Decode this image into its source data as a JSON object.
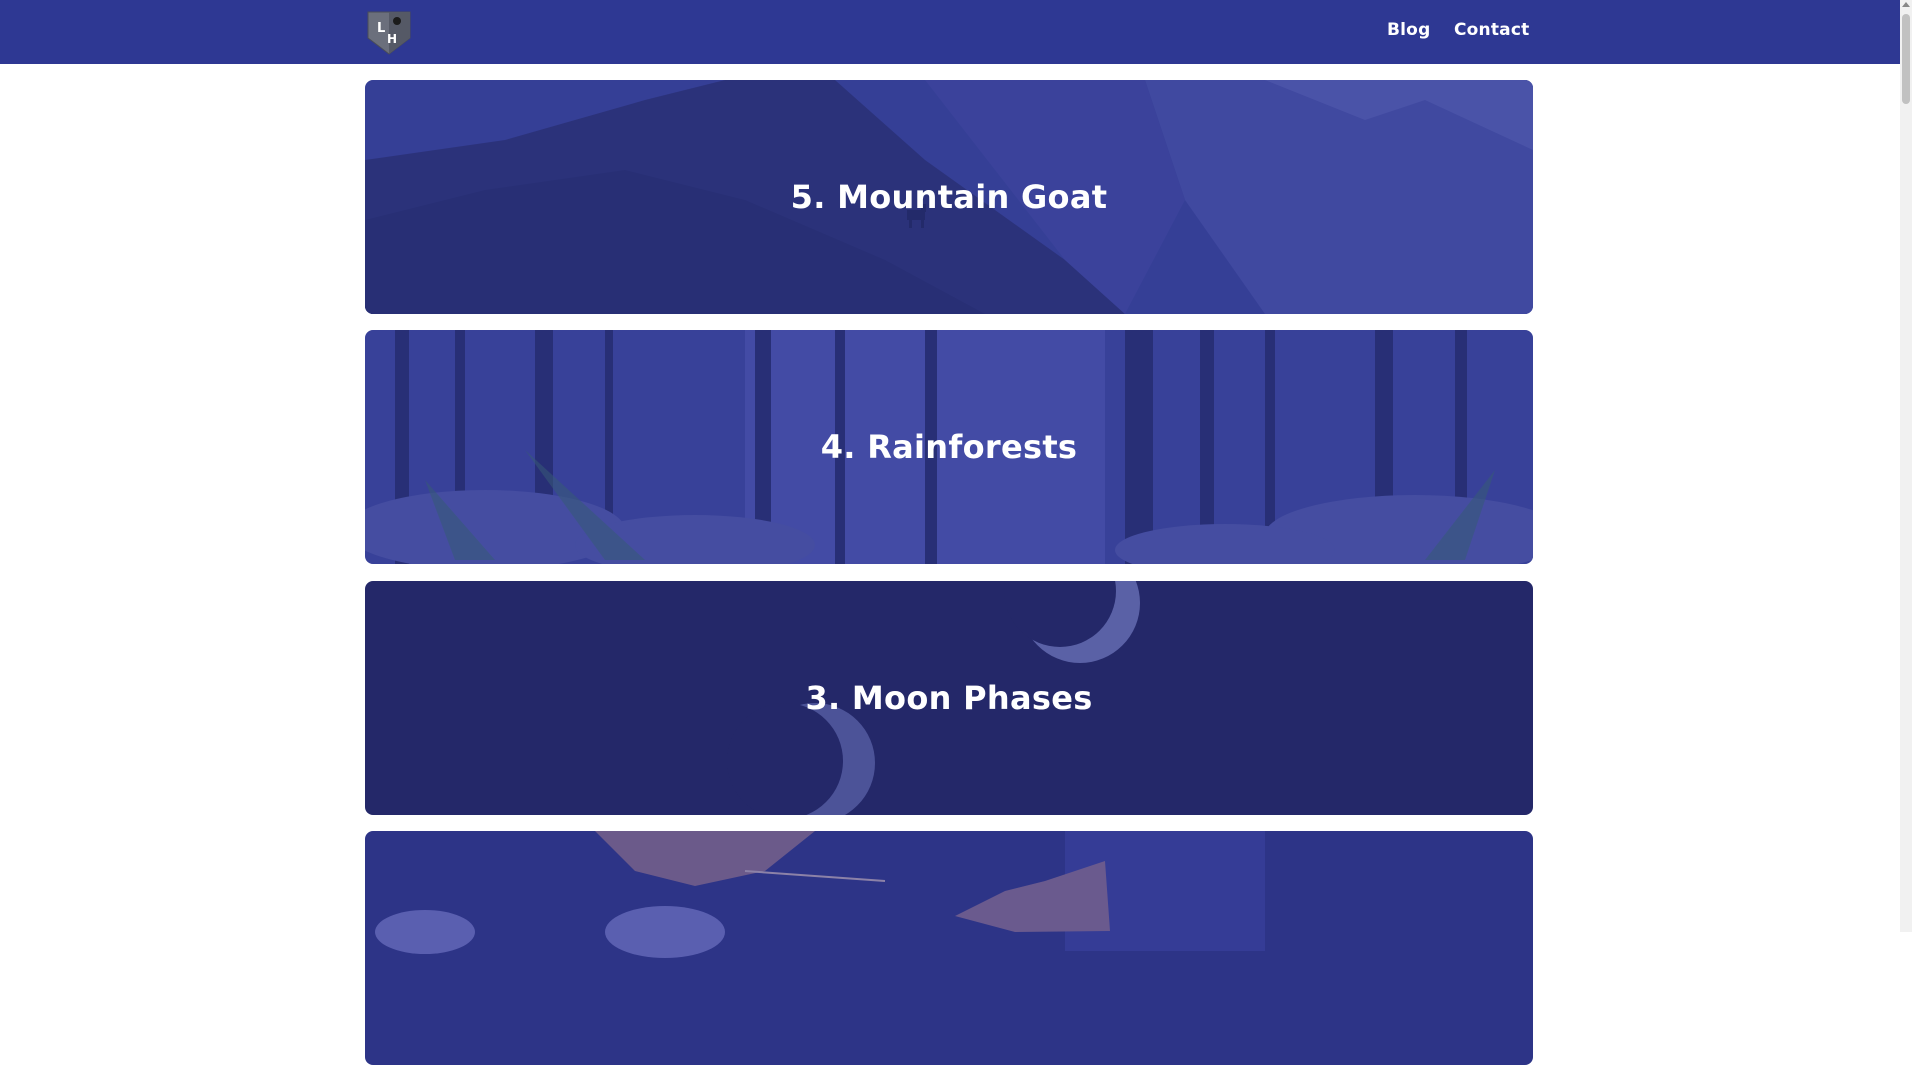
{
  "nav": {
    "logo_icon": "shield-logo-icon",
    "logo_letters": "LH",
    "links": [
      "Blog",
      "Contact"
    ]
  },
  "cards": [
    {
      "title": "5. Mountain Goat",
      "image": "mountain-goat-image"
    },
    {
      "title": "4. Rainforests",
      "image": "rainforest-image"
    },
    {
      "title": "3. Moon Phases",
      "image": "moon-phases-image"
    },
    {
      "title": "",
      "image": "butterflies-image"
    }
  ],
  "colors": {
    "navbar": "#2e3893",
    "card_overlay": "#2e3893",
    "background": "#ffffff"
  }
}
